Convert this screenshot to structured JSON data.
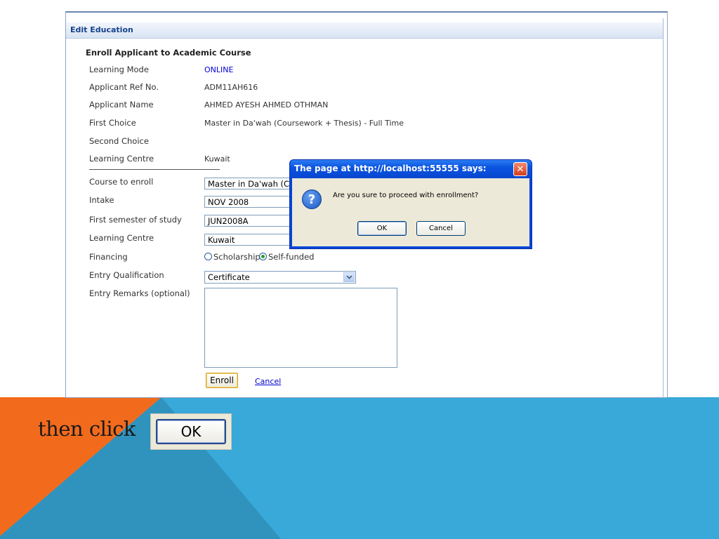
{
  "panel": {
    "header_title": "Edit Education",
    "section_title": "Enroll Applicant to Academic Course"
  },
  "info": [
    {
      "label": "Learning Mode",
      "value": "ONLINE"
    },
    {
      "label": "Applicant Ref No.",
      "value": "ADM11AH616"
    },
    {
      "label": "Applicant Name",
      "value": "AHMED AYESH AHMED OTHMAN"
    },
    {
      "label": "First Choice",
      "value": "Master in Da'wah (Coursework + Thesis) - Full Time"
    },
    {
      "label": "Second Choice",
      "value": ""
    },
    {
      "label": "Learning Centre",
      "value": "Kuwait"
    }
  ],
  "form": {
    "course_label": "Course to enroll",
    "course_value": "Master in Da'wah (C",
    "intake_label": "Intake",
    "intake_value": "NOV 2008",
    "semester_label": "First semester of study",
    "semester_value": "JUN2008A",
    "centre_label": "Learning Centre",
    "centre_value": "Kuwait",
    "financing_label": "Financing",
    "financing_options": [
      "Scholarship",
      "Self-funded"
    ],
    "financing_selected": "Self-funded",
    "qualification_label": "Entry Qualification",
    "qualification_value": "Certificate",
    "remarks_label": "Entry Remarks (optional)",
    "remarks_value": "",
    "enroll_label": "Enroll",
    "cancel_label": "Cancel"
  },
  "dialog": {
    "title": "The page at http://localhost:55555 says:",
    "message": "Are you sure to proceed with enrollment?",
    "ok_label": "OK",
    "cancel_label": "Cancel",
    "close_glyph": "✕",
    "icon_glyph": "?"
  },
  "slide": {
    "caption": "then click",
    "ok_sample_label": "OK",
    "colors": {
      "orange": "#f26b1d",
      "blue": "#38a9d9",
      "dark_blue": "#2f8fb8"
    }
  }
}
